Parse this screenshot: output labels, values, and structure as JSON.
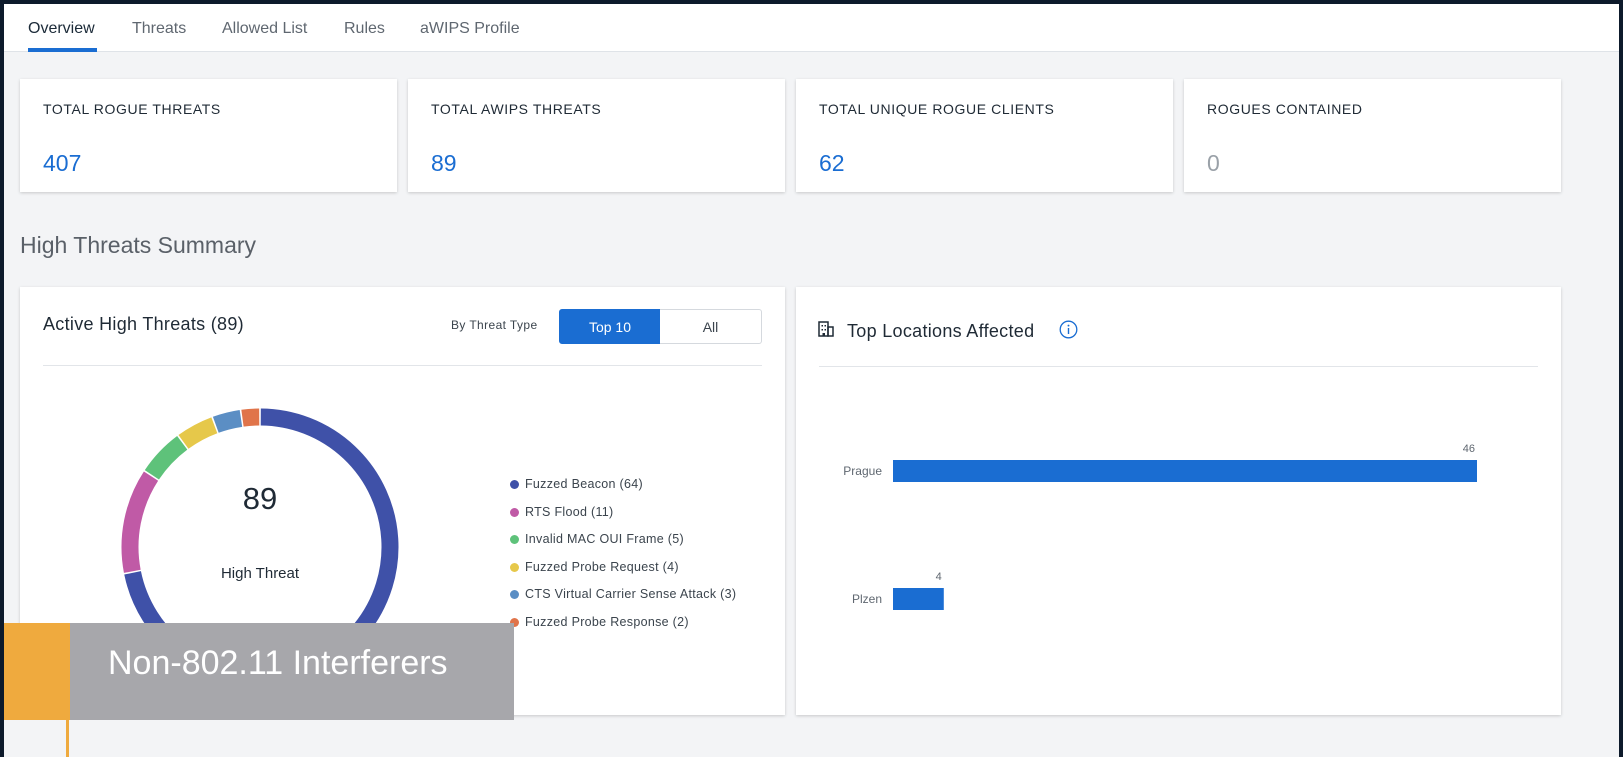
{
  "tabs": [
    {
      "label": "Overview",
      "active": true
    },
    {
      "label": "Threats"
    },
    {
      "label": "Allowed List"
    },
    {
      "label": "Rules"
    },
    {
      "label": "aWIPS Profile"
    }
  ],
  "kpis": [
    {
      "title": "TOTAL ROGUE THREATS",
      "value": "407"
    },
    {
      "title": "TOTAL AWIPS THREATS",
      "value": "89"
    },
    {
      "title": "TOTAL UNIQUE ROGUE CLIENTS",
      "value": "62"
    },
    {
      "title": "ROGUES CONTAINED",
      "value": "0"
    }
  ],
  "section_title": "High Threats Summary",
  "active_threats": {
    "title": "Active High Threats (89)",
    "by_label": "By Threat Type",
    "toggle": {
      "top10": "Top 10",
      "all": "All",
      "selected": "Top 10"
    },
    "center_value": "89",
    "center_label": "High Threat",
    "legend": [
      "Fuzzed Beacon (64)",
      "RTS Flood (11)",
      "Invalid MAC OUI Frame (5)",
      "Fuzzed Probe Request (4)",
      "CTS Virtual Carrier Sense Attack (3)",
      "Fuzzed Probe Response (2)"
    ]
  },
  "top_locations": {
    "title": "Top Locations Affected",
    "icon": "building-icon",
    "info_icon": "info-icon",
    "bar_color": "#1a6dd2"
  },
  "overlay": {
    "text": "Non-802.11 Interferers",
    "accent_color": "#efaa3e"
  },
  "colors": {
    "accent": "#1a6dd2"
  },
  "chart_data": [
    {
      "type": "pie",
      "categories": [
        "Fuzzed Beacon",
        "RTS Flood",
        "Invalid MAC OUI Frame",
        "Fuzzed Probe Request",
        "CTS Virtual Carrier Sense Attack",
        "Fuzzed Probe Response"
      ],
      "values": [
        64,
        11,
        5,
        4,
        3,
        2
      ],
      "colors": [
        "#3f51a8",
        "#c05aa6",
        "#5ec27a",
        "#e6c84a",
        "#5b8ec4",
        "#e0744a"
      ]
    },
    {
      "type": "bar",
      "orientation": "horizontal",
      "categories": [
        "Prague",
        "Plzen"
      ],
      "values": [
        46,
        4
      ],
      "grid": false
    }
  ]
}
